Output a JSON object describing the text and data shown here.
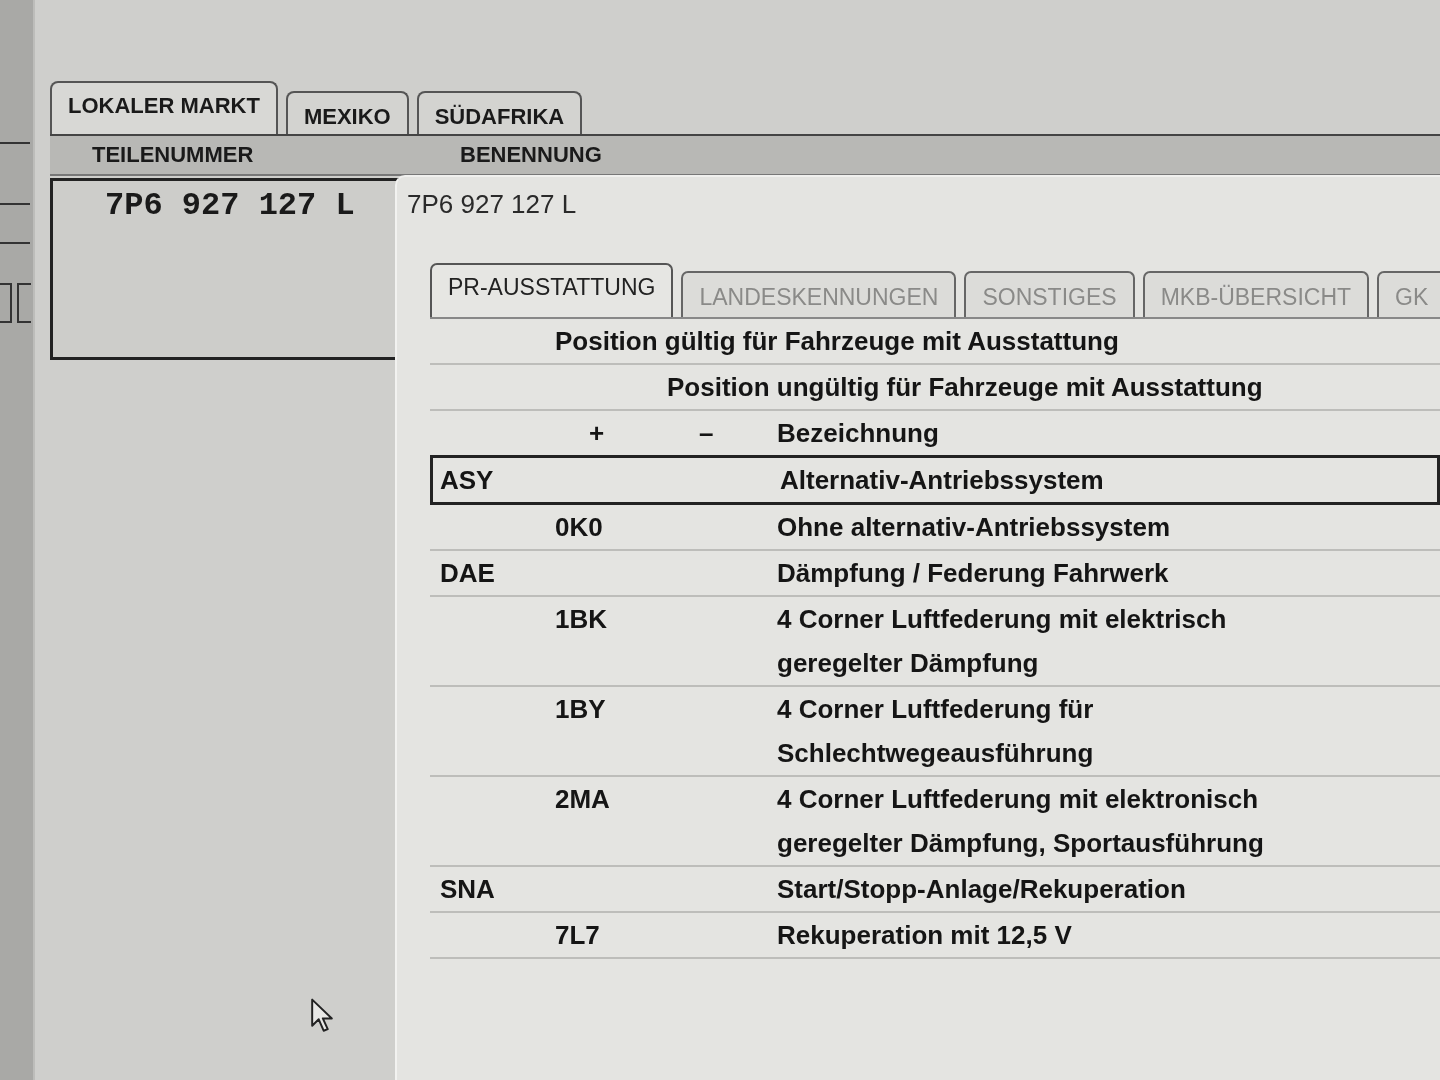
{
  "market_tabs": [
    {
      "label": "LOKALER MARKT",
      "selected": true
    },
    {
      "label": "MEXIKO",
      "selected": false
    },
    {
      "label": "SÜDAFRIKA",
      "selected": false
    }
  ],
  "parts_table": {
    "columns": [
      "TEILENUMMER",
      "BENENNUNG"
    ],
    "rows": [
      {
        "part_number": "7P6 927 127 L"
      }
    ]
  },
  "detail_panel": {
    "part_number": "7P6 927 127 L",
    "tabs": [
      {
        "label": "PR-AUSSTATTUNG",
        "selected": true,
        "disabled": false
      },
      {
        "label": "LANDESKENNUNGEN",
        "selected": false,
        "disabled": true
      },
      {
        "label": "SONSTIGES",
        "selected": false,
        "disabled": true
      },
      {
        "label": "MKB-ÜBERSICHT",
        "selected": false,
        "disabled": true
      },
      {
        "label": "GK",
        "selected": false,
        "disabled": true
      }
    ],
    "equipment_table": {
      "header_valid": "Position gültig für Fahrzeuge mit Ausstattung",
      "header_invalid": "Position ungültig für Fahrzeuge mit Ausstattung",
      "columns": [
        "+",
        "–",
        "Bezeichnung"
      ],
      "rows": [
        {
          "kind": "family",
          "code": "ASY",
          "description": "Alternativ-Antriebssystem",
          "selected": true
        },
        {
          "kind": "option",
          "code": "0K0",
          "description": "Ohne alternativ-Antriebssystem",
          "selected": false
        },
        {
          "kind": "family",
          "code": "DAE",
          "description": "Dämpfung / Federung Fahrwerk",
          "selected": false
        },
        {
          "kind": "option",
          "code": "1BK",
          "description": "4 Corner Luftfederung mit elektrisch geregelter Dämpfung",
          "selected": false
        },
        {
          "kind": "option",
          "code": "1BY",
          "description": "4 Corner Luftfederung für Schlechtwegeausführung",
          "selected": false
        },
        {
          "kind": "option",
          "code": "2MA",
          "description": "4 Corner Luftfederung mit elektronisch geregelter Dämpfung, Sportausführung",
          "selected": false
        },
        {
          "kind": "family",
          "code": "SNA",
          "description": "Start/Stopp-Anlage/Rekuperation",
          "selected": false
        },
        {
          "kind": "option",
          "code": "7L7",
          "description": "Rekuperation mit 12,5 V",
          "selected": false
        }
      ]
    }
  }
}
